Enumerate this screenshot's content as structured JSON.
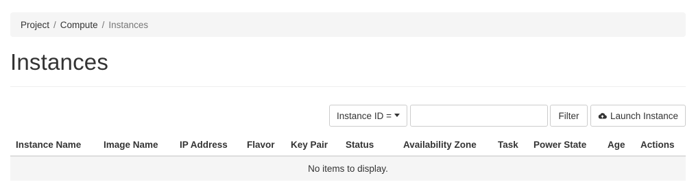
{
  "breadcrumb": {
    "items": [
      "Project",
      "Compute"
    ],
    "separator": "/",
    "current": "Instances"
  },
  "page": {
    "title": "Instances"
  },
  "toolbar": {
    "filter_field_label": "Instance ID =",
    "filter_input_value": "",
    "filter_button_label": "Filter",
    "launch_button_label": "Launch Instance",
    "launch_icon": "cloud-upload-icon"
  },
  "table": {
    "columns": [
      "Instance Name",
      "Image Name",
      "IP Address",
      "Flavor",
      "Key Pair",
      "Status",
      "Availability Zone",
      "Task",
      "Power State",
      "Age",
      "Actions"
    ],
    "empty_message": "No items to display."
  },
  "colors": {
    "breadcrumb_bg": "#f5f5f5",
    "text": "#333333",
    "muted_text": "#777777",
    "border": "#cccccc"
  }
}
